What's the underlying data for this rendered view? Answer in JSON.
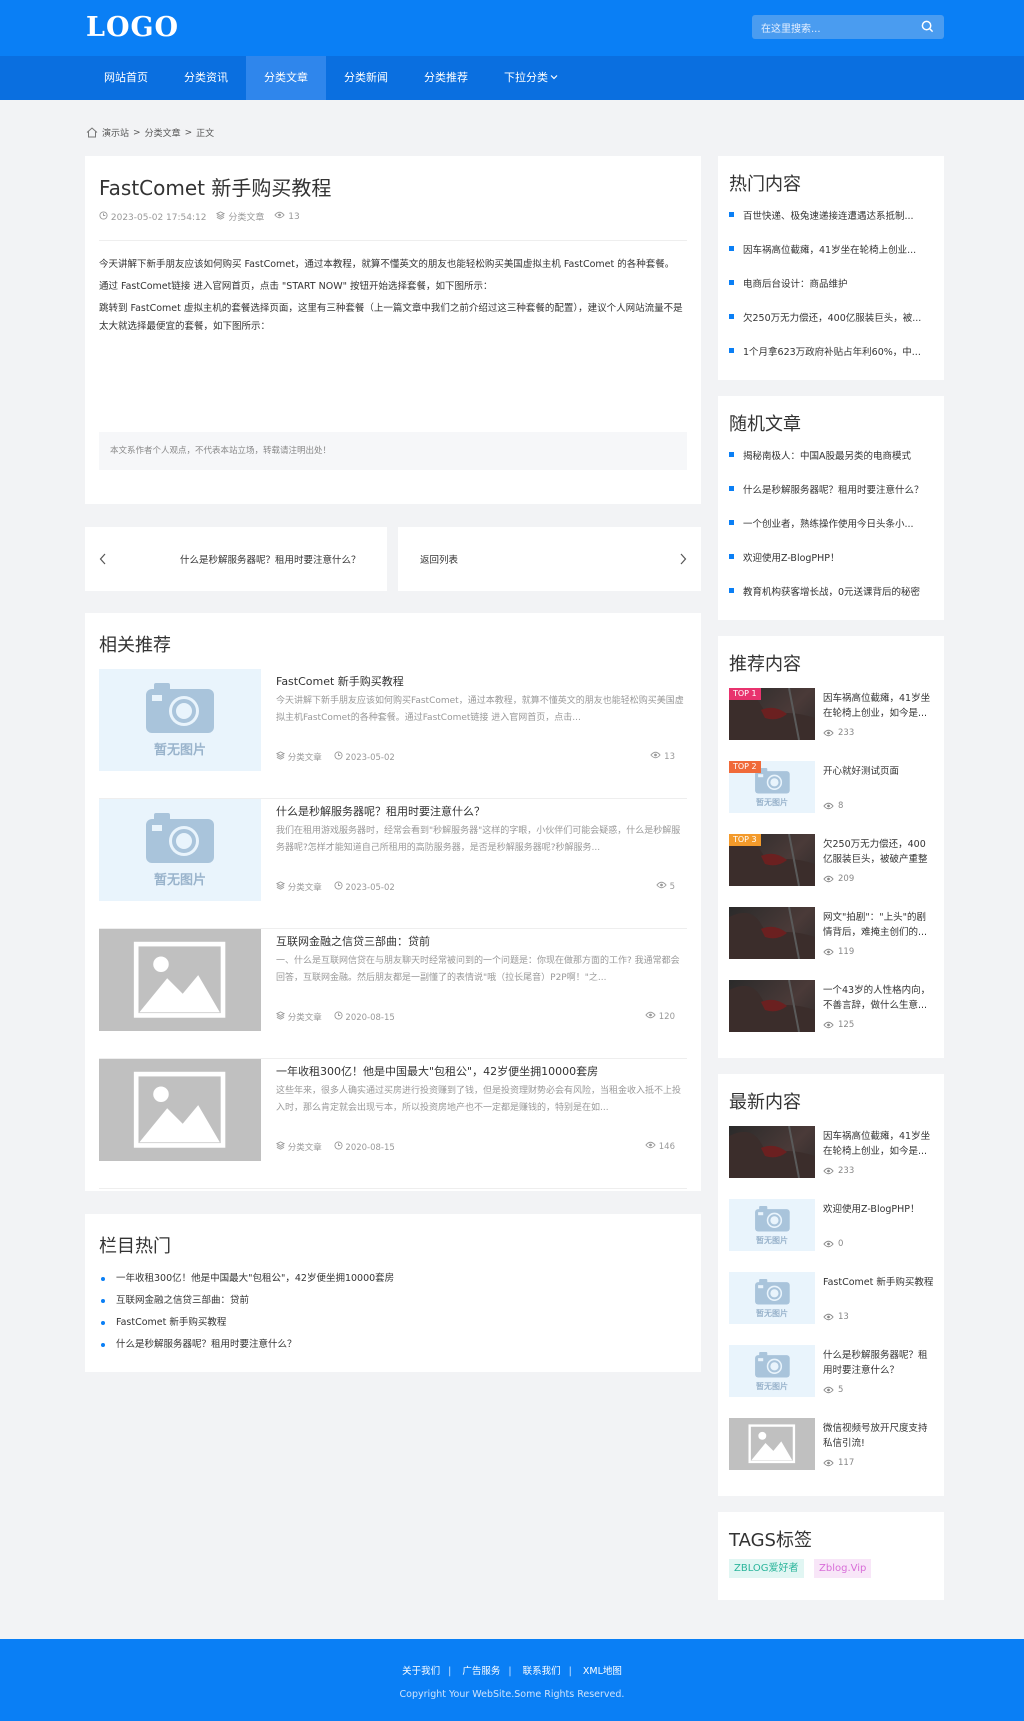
{
  "header": {
    "logo": "LOGO",
    "search_placeholder": "在这里搜索..."
  },
  "nav": [
    "网站首页",
    "分类资讯",
    "分类文章",
    "分类新闻",
    "分类推荐",
    "下拉分类"
  ],
  "breadcrumb": [
    "演示站",
    "分类文章",
    "正文"
  ],
  "article": {
    "title": "FastComet 新手购买教程",
    "date": "2023-05-02 17:54:12",
    "category": "分类文章",
    "views": "13",
    "paragraphs": [
      "今天讲解下新手朋友应该如何购买 FastComet，通过本教程，就算不懂英文的朋友也能轻松购买美国虚拟主机 FastComet 的各种套餐。",
      "通过 FastComet链接 进入官网首页，点击 \"START NOW\" 按钮开始选择套餐，如下图所示：",
      "跳转到 FastComet 虚拟主机的套餐选择页面，这里有三种套餐（上一篇文章中我们之前介绍过这三种套餐的配置），建议个人网站流量不是太大就选择最便宜的套餐，如下图所示："
    ],
    "note": "本文系作者个人观点，不代表本站立场，转载请注明出处！"
  },
  "prev_next": {
    "prev": "什么是秒解服务器呢？租用时要注意什么？",
    "back": "返回列表"
  },
  "related": {
    "title": "相关推荐",
    "no_image": "暂无图片",
    "items": [
      {
        "title": "FastComet 新手购买教程",
        "desc": "今天讲解下新手朋友应该如何购买FastComet，通过本教程，就算不懂英文的朋友也能轻松购买美国虚拟主机FastComet的各种套餐。通过FastComet链接 进入官网首页，点击...",
        "category": "分类文章",
        "date": "2023-05-02",
        "views": "13",
        "thumb": "none"
      },
      {
        "title": "什么是秒解服务器呢？租用时要注意什么？",
        "desc": "我们在租用游戏服务器时，经常会看到\"秒解服务器\"这样的字眼，小伙伴们可能会疑惑，什么是秒解服务器呢?怎样才能知道自己所租用的高防服务器，是否是秒解服务器呢?秒解服务...",
        "category": "分类文章",
        "date": "2023-05-02",
        "views": "5",
        "thumb": "none"
      },
      {
        "title": "互联网金融之信贷三部曲：贷前",
        "desc": "一、什么是互联网信贷在与朋友聊天时经常被问到的一个问题是：你现在做那方面的工作? 我通常都会回答，互联网金融。然后朋友都是一副懂了的表情说\"哦（拉长尾音）P2P啊！\"之...",
        "category": "分类文章",
        "date": "2020-08-15",
        "views": "120",
        "thumb": "gray"
      },
      {
        "title": "一年收租300亿！他是中国最大\"包租公\"，42岁便坐拥10000套房",
        "desc": "这些年来，很多人确实通过买房进行投资赚到了钱，但是投资理财势必会有风险，当租金收入抵不上投入时，那么肯定就会出现亏本，所以投资房地产也不一定都是赚钱的，特别是在如...",
        "category": "分类文章",
        "date": "2020-08-15",
        "views": "146",
        "thumb": "gray"
      }
    ]
  },
  "column_hot": {
    "title": "栏目热门",
    "items": [
      "一年收租300亿！他是中国最大\"包租公\"，42岁便坐拥10000套房",
      "互联网金融之信贷三部曲：贷前",
      "FastComet 新手购买教程",
      "什么是秒解服务器呢？租用时要注意什么？"
    ]
  },
  "hot": {
    "title": "热门内容",
    "items": [
      "百世快递、极兔速递接连遭遇达系抵制...",
      "因车祸高位截瘫，41岁坐在轮椅上创业...",
      "电商后台设计：商品维护",
      "欠250万无力偿还，400亿服装巨头，被...",
      "1个月拿623万政府补贴占年利60%，中..."
    ]
  },
  "random": {
    "title": "随机文章",
    "items": [
      "揭秘南极人：中国A股最另类的电商模式",
      "什么是秒解服务器呢？租用时要注意什么？",
      "一个创业者，熟练操作使用今日头条小...",
      "欢迎使用Z-BlogPHP！",
      "教育机构获客增长战，0元送课背后的秘密"
    ]
  },
  "recommend": {
    "title": "推荐内容",
    "no_image": "暂无图片",
    "items": [
      {
        "badge": "TOP 1",
        "title": "因车祸高位截瘫，41岁坐在轮椅上创业，如今是...",
        "views": "233",
        "thumb": "dark"
      },
      {
        "badge": "TOP 2",
        "title": "开心就好测试页面",
        "views": "8",
        "thumb": "none"
      },
      {
        "badge": "TOP 3",
        "title": "欠250万无力偿还，400亿服装巨头，被破产重整",
        "views": "209",
        "thumb": "dark"
      },
      {
        "badge": "",
        "title": "网文\"拍剧\"：\"上头\"的剧情背后，难掩主创们的...",
        "views": "119",
        "thumb": "dark"
      },
      {
        "badge": "",
        "title": "一个43岁的人性格内向，不善言辞，做什么生意...",
        "views": "125",
        "thumb": "dark"
      }
    ]
  },
  "latest": {
    "title": "最新内容",
    "no_image": "暂无图片",
    "items": [
      {
        "title": "因车祸高位截瘫，41岁坐在轮椅上创业，如今是...",
        "views": "233",
        "thumb": "dark"
      },
      {
        "title": "欢迎使用Z-BlogPHP！",
        "views": "0",
        "thumb": "none"
      },
      {
        "title": "FastComet 新手购买教程",
        "views": "13",
        "thumb": "none"
      },
      {
        "title": "什么是秒解服务器呢？租用时要注意什么？",
        "views": "5",
        "thumb": "none"
      },
      {
        "title": "微信视频号放开尺度支持私信引流!",
        "views": "117",
        "thumb": "gray"
      }
    ]
  },
  "tags": {
    "title": "TAGS标签",
    "items": [
      "ZBLOG爱好者",
      "Zblog.Vip"
    ]
  },
  "footer": {
    "links": [
      "关于我们",
      "广告服务",
      "联系我们",
      "XML地图"
    ],
    "separator": "|",
    "copyright": "Copyright Your WebSite.Some Rights Reserved."
  },
  "colors": {
    "primary": "#0a7ff5",
    "nav": "#0a6fe0",
    "top1": "#e8336e",
    "top2": "#f06a3a",
    "top3": "#f39a2b",
    "tag1_bg": "#e1f6f3",
    "tag1_fg": "#2bb59b",
    "tag2_bg": "#f8e6f8",
    "tag2_fg": "#d86ed8"
  }
}
